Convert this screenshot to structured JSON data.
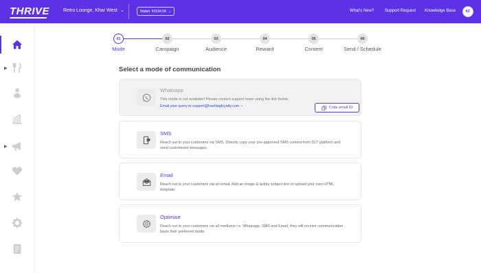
{
  "header": {
    "logo": "THRIVE",
    "store_name": "Retro Lounge, Khar West",
    "wallet": "Wallet: ₹2034.58",
    "nav": [
      "What's New?",
      "Support Request",
      "Knowledge Base"
    ],
    "avatar_initials": "KF",
    "accent_color": "#5b32e6"
  },
  "sidebar": {
    "items": [
      {
        "icon": "home-icon",
        "active": true
      },
      {
        "icon": "fork-knife-icon",
        "expandable": true
      },
      {
        "icon": "user-icon"
      },
      {
        "icon": "chart-icon"
      },
      {
        "icon": "megaphone-icon",
        "expandable": true
      },
      {
        "icon": "heart-icon"
      },
      {
        "icon": "star-icon"
      },
      {
        "icon": "gear-icon"
      },
      {
        "icon": "receipt-icon"
      }
    ]
  },
  "stepper": {
    "steps": [
      {
        "num": "01",
        "label": "Mode",
        "active": true
      },
      {
        "num": "02",
        "label": "Campaign"
      },
      {
        "num": "03",
        "label": "Audience"
      },
      {
        "num": "04",
        "label": "Reward"
      },
      {
        "num": "05",
        "label": "Content"
      },
      {
        "num": "06",
        "label": "Send / Schedule"
      }
    ]
  },
  "main": {
    "heading": "Select a mode of communication",
    "modes": [
      {
        "title": "Whatsapp",
        "description": "This mode is not available! Please contact support team using the link below.",
        "link": "Email your query to support@hashtagloyalty.com",
        "button": "Copy email ID",
        "disabled": true
      },
      {
        "title": "SMS",
        "description": "Reach out to your customers via SMS. Directly copy your pre-approved SMS content from DLT platform and send customised messages."
      },
      {
        "title": "Email",
        "description": "Reach out to your customers via an email. Add an image & quirky subject line or upload your own HTML template."
      },
      {
        "title": "Optimise",
        "description": "Reach out to your customers via all mediums i.e. Whatsapp, SMS and Email, they will receive communication basis their preferred mode."
      }
    ]
  }
}
